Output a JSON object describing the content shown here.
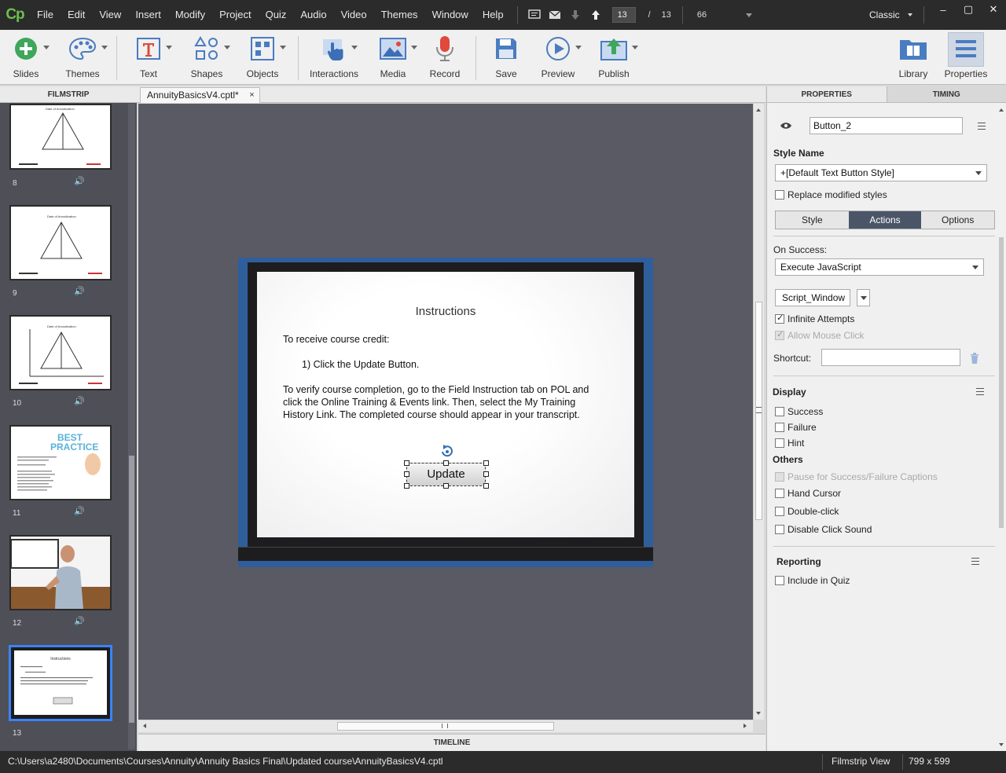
{
  "app": {
    "logo": "Cp",
    "menu": [
      "File",
      "Edit",
      "View",
      "Insert",
      "Modify",
      "Project",
      "Quiz",
      "Audio",
      "Video",
      "Themes",
      "Window",
      "Help"
    ],
    "current_slide": "13",
    "slide_separator": "/",
    "total_slides": "13",
    "zoom": "66",
    "workspace": "Classic",
    "window_buttons": [
      "–",
      "▢",
      "✕"
    ]
  },
  "toolbar": {
    "buttons": [
      "Slides",
      "Themes",
      "Text",
      "Shapes",
      "Objects",
      "Interactions",
      "Media",
      "Record",
      "Save",
      "Preview",
      "Publish",
      "Library",
      "Properties"
    ]
  },
  "filmstrip": {
    "header": "FILMSTRIP",
    "slides": [
      {
        "number": "8",
        "title": "Date of Annuitization",
        "audio_icon": "speaker-icon"
      },
      {
        "number": "9",
        "title": "Date of Annuitization",
        "audio_icon": "speaker-icon"
      },
      {
        "number": "10",
        "title": "Date of Annuitization",
        "audio_icon": "speaker-icon"
      },
      {
        "number": "11",
        "title": "BEST PRACTICE",
        "audio_icon": "speaker-icon"
      },
      {
        "number": "12",
        "title": "",
        "audio_icon": "speaker-icon"
      },
      {
        "number": "13",
        "title": "Instructions",
        "audio_icon": ""
      }
    ]
  },
  "document": {
    "tab_label": "AnnuityBasicsV4.cptl*",
    "tab_close": "×",
    "timeline_label": "TIMELINE"
  },
  "slide": {
    "title": "Instructions",
    "line1": "To receive course credit:",
    "line2": "1) Click the Update Button.",
    "para_lines": [
      "To verify course completion, go to the Field Instruction tab on POL and",
      "click the Online Training & Events link.  Then, select the My Training",
      "History Link. The completed course should appear in your transcript."
    ],
    "button_label": "Update"
  },
  "properties": {
    "tabs": [
      "PROPERTIES",
      "TIMING"
    ],
    "object_name": "Button_2",
    "style_name_label": "Style Name",
    "style_name_value": "+[Default Text Button Style]",
    "replace_modified_styles": "Replace modified styles",
    "segments": [
      "Style",
      "Actions",
      "Options"
    ],
    "active_segment": "Actions",
    "on_success_label": "On Success:",
    "on_success_value": "Execute JavaScript",
    "script_window": "Script_Window",
    "infinite_attempts": "Infinite Attempts",
    "allow_mouse_click": "Allow Mouse Click",
    "shortcut_label": "Shortcut:",
    "shortcut_value": "",
    "display_header": "Display",
    "display_items": [
      "Success",
      "Failure",
      "Hint"
    ],
    "others_header": "Others",
    "others_items": [
      "Pause for Success/Failure Captions",
      "Hand Cursor",
      "Double-click",
      "Disable Click Sound"
    ],
    "reporting_header": "Reporting",
    "include_in_quiz": "Include in Quiz"
  },
  "status": {
    "path": "C:\\Users\\a2480\\Documents\\Courses\\Annuity\\Annuity Basics Final\\Updated course\\AnnuityBasicsV4.cptl",
    "view": "Filmstrip View",
    "dimensions": "799 x 599"
  }
}
